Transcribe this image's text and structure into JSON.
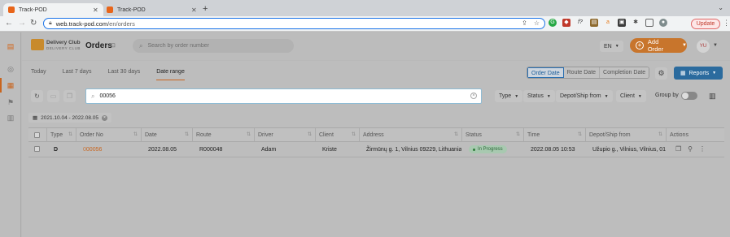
{
  "browser": {
    "tabs": [
      {
        "title": "Track-POD",
        "active": true
      },
      {
        "title": "Track-POD",
        "active": false
      }
    ],
    "new_tab": "+",
    "url_host": "web.track-pod.com",
    "url_path": "/en/orders",
    "update_label": "Update"
  },
  "header": {
    "brand_name": "Delivery Club",
    "brand_sub": "DELIVERY CLUB",
    "title": "Orders",
    "search_placeholder": "Search by order number",
    "language": "EN",
    "add_order_label": "Add Order",
    "avatar_initials": "YU"
  },
  "date_tabs": [
    "Today",
    "Last 7 days",
    "Last 30 days",
    "Date range"
  ],
  "date_tab_active": "Date range",
  "date_type_options": [
    "Order Date",
    "Route Date",
    "Completion Date"
  ],
  "date_type_selected": "Order Date",
  "reports_label": "Reports",
  "order_search_value": "00056",
  "filters": [
    "Type",
    "Status",
    "Depot/Ship from",
    "Client"
  ],
  "group_by_label": "Group by",
  "date_range_chip": "2021.10.04 - 2022.08.05",
  "table": {
    "columns": [
      "Type",
      "Order No",
      "Date",
      "Route",
      "Driver",
      "Client",
      "Address",
      "Status",
      "Time",
      "Depot/Ship from",
      "Actions"
    ],
    "rows": [
      {
        "type": "D",
        "order_prefix": "0",
        "order_hl": "00056",
        "date": "2022.08.05",
        "route": "R000048",
        "driver": "Adam",
        "client": "Kriste",
        "address": "Žirmūnų g. 1, Vilnius 09229, Lithuania",
        "status": "In Progress",
        "time": "2022.08.05 10:53",
        "depot": "Užupio g., Vilnius, Vilnius, 01..."
      }
    ]
  },
  "colors": {
    "accent": "#c9651e",
    "reports": "#2b6b9e",
    "status_green": "#2e6b3a"
  }
}
